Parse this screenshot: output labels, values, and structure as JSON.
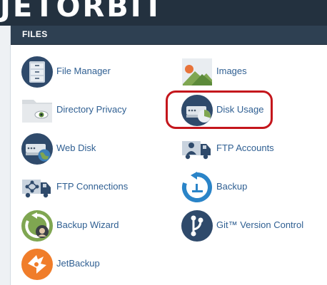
{
  "brand": {
    "logo_text": "JETORBIT"
  },
  "panel": {
    "title": "FILES"
  },
  "items": [
    {
      "label": "File Manager",
      "icon": "file-manager-icon"
    },
    {
      "label": "Images",
      "icon": "images-icon"
    },
    {
      "label": "Directory Privacy",
      "icon": "directory-privacy-icon"
    },
    {
      "label": "Disk Usage",
      "icon": "disk-usage-icon"
    },
    {
      "label": "Web Disk",
      "icon": "web-disk-icon"
    },
    {
      "label": "FTP Accounts",
      "icon": "ftp-accounts-icon"
    },
    {
      "label": "FTP Connections",
      "icon": "ftp-connections-icon"
    },
    {
      "label": "Backup",
      "icon": "backup-icon"
    },
    {
      "label": "Backup Wizard",
      "icon": "backup-wizard-icon"
    },
    {
      "label": "Git™ Version Control",
      "icon": "git-icon"
    },
    {
      "label": "JetBackup",
      "icon": "jetbackup-icon"
    }
  ],
  "colors": {
    "link": "#2f5f92",
    "header": "#2e4052",
    "highlight": "#c4161c"
  }
}
